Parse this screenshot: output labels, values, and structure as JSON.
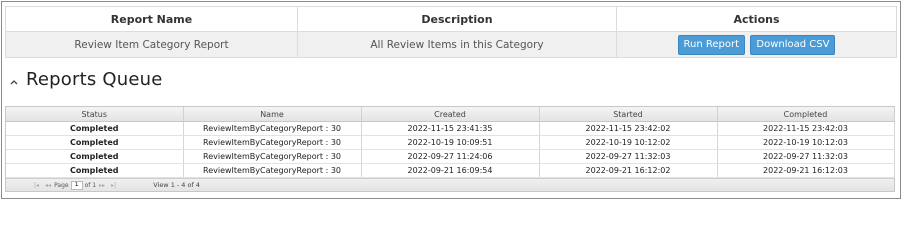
{
  "report_table": {
    "headers": {
      "name": "Report Name",
      "description": "Description",
      "actions": "Actions"
    },
    "row": {
      "name": "Review Item Category Report",
      "description": "All Review Items in this Category",
      "run_label": "Run Report",
      "download_label": "Download CSV"
    }
  },
  "queue": {
    "title": "Reports Queue",
    "columns": {
      "status": "Status",
      "name": "Name",
      "created": "Created",
      "started": "Started",
      "completed": "Completed"
    },
    "rows": [
      {
        "status": "Completed",
        "name": "ReviewItemByCategoryReport : 30",
        "created": "2022-11-15 23:41:35",
        "started": "2022-11-15 23:42:02",
        "completed": "2022-11-15 23:42:03"
      },
      {
        "status": "Completed",
        "name": "ReviewItemByCategoryReport : 30",
        "created": "2022-10-19 10:09:51",
        "started": "2022-10-19 10:12:02",
        "completed": "2022-10-19 10:12:03"
      },
      {
        "status": "Completed",
        "name": "ReviewItemByCategoryReport : 30",
        "created": "2022-09-27 11:24:06",
        "started": "2022-09-27 11:32:03",
        "completed": "2022-09-27 11:32:03"
      },
      {
        "status": "Completed",
        "name": "ReviewItemByCategoryReport : 30",
        "created": "2022-09-21 16:09:54",
        "started": "2022-09-21 16:12:02",
        "completed": "2022-09-21 16:12:03"
      }
    ],
    "pager": {
      "page_label": "Page",
      "page_value": "1",
      "of_label": "of 1",
      "view_text": "View 1 - 4 of 4"
    }
  },
  "colors": {
    "button": "#4a9bd6",
    "status_completed": "#2e7d1e"
  },
  "icons": {
    "collapse": "chevron-up-icon"
  }
}
